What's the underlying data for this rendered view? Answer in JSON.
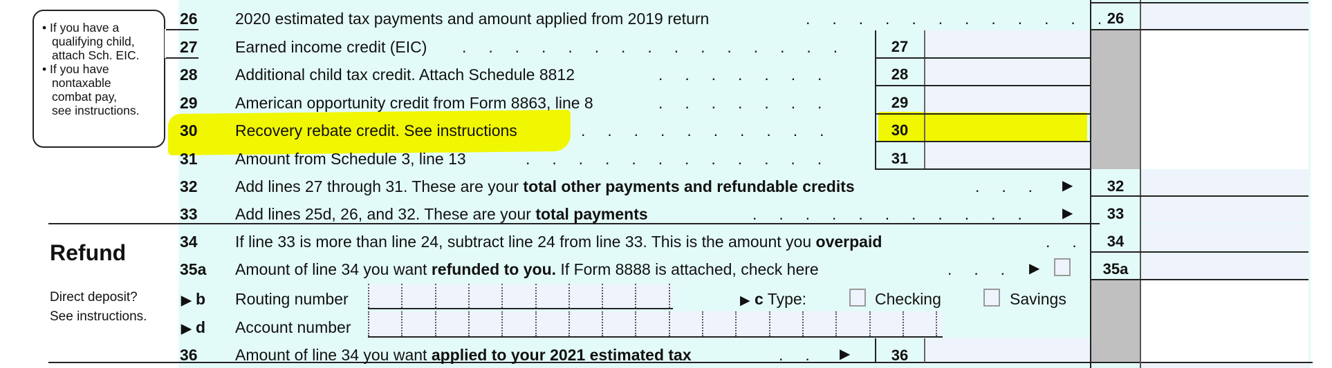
{
  "callout": {
    "items": [
      "• If you have a",
      "qualifying child,",
      "attach Sch. EIC.",
      "• If you have",
      "nontaxable",
      "combat pay,",
      "see instructions."
    ]
  },
  "section": {
    "refund_title": "Refund",
    "direct_deposit_1": "Direct deposit?",
    "direct_deposit_2": "See instructions."
  },
  "lines": {
    "l26": {
      "num": "26",
      "text": "2020 estimated tax payments and amount applied from 2019 return",
      "box": "26"
    },
    "l27": {
      "num": "27",
      "text": "Earned income credit (EIC)",
      "box": "27"
    },
    "l28": {
      "num": "28",
      "text": "Additional child tax credit. Attach Schedule 8812",
      "box": "28"
    },
    "l29": {
      "num": "29",
      "text": "American opportunity credit from Form 8863, line 8",
      "box": "29"
    },
    "l30": {
      "num": "30",
      "text": "Recovery rebate credit. See instructions",
      "box": "30"
    },
    "l31": {
      "num": "31",
      "text": "Amount from Schedule 3, line 13",
      "box": "31"
    },
    "l32": {
      "num": "32",
      "text_pre": "Add lines 27 through 31. These are your ",
      "text_bold": "total other payments and refundable credits",
      "box": "32"
    },
    "l33": {
      "num": "33",
      "text_pre": "Add lines 25d, 26, and 32. These are your ",
      "text_bold": "total payments",
      "box": "33"
    },
    "l34": {
      "num": "34",
      "text_pre": "If line 33 is more than line 24, subtract line 24 from line 33. This is the amount you ",
      "text_bold": "overpaid",
      "box": "34"
    },
    "l35a": {
      "num": "35a",
      "text_pre": "Amount of line 34 you want ",
      "text_bold": "refunded to you.",
      "text_post": " If Form 8888 is attached, check here",
      "box": "35a"
    },
    "l35b": {
      "num": "b",
      "label": "Routing number"
    },
    "l35c": {
      "num": "c",
      "label": "Type:",
      "checking": "Checking",
      "savings": "Savings"
    },
    "l35d": {
      "num": "d",
      "label": "Account number"
    },
    "l36": {
      "num": "36",
      "text_pre": "Amount of line 34 you want ",
      "text_bold": "applied to your 2021 estimated tax",
      "box": "36"
    }
  },
  "fields": {
    "routing_digits": 9,
    "account_digits": 17
  },
  "colors": {
    "form_bg": "#e3fbf8",
    "field_bg": "#eef3fc",
    "shaded": "#c0c0c0",
    "highlight": "#f1f700"
  }
}
